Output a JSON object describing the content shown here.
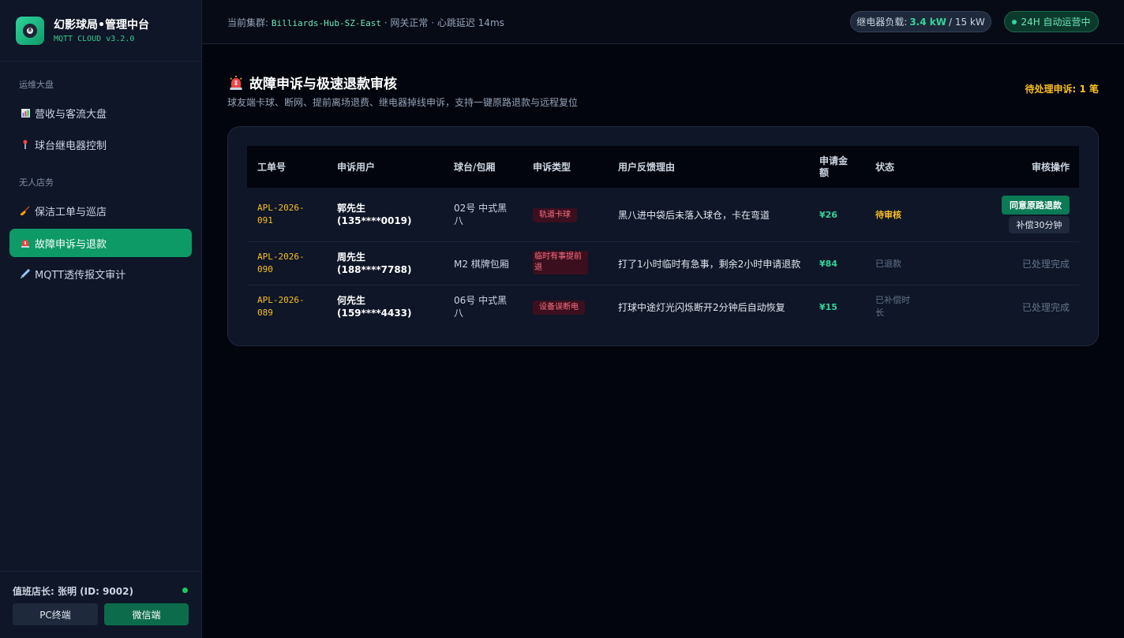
{
  "brand": {
    "title": "幻影球局•管理中台",
    "version": "MQTT CLOUD v3.2.0"
  },
  "sidebar": {
    "sections": [
      {
        "title": "运维大盘"
      },
      {
        "title": "无人店务"
      }
    ],
    "items": [
      {
        "label": "营收与客流大盘",
        "icon": "bar-chart-icon"
      },
      {
        "label": "球台继电器控制",
        "icon": "switch-icon"
      },
      {
        "label": "保洁工单与巡店",
        "icon": "broom-icon"
      },
      {
        "label": "故障申诉与退款",
        "icon": "siren-icon"
      },
      {
        "label": "MQTT透传报文审计",
        "icon": "syringe-icon"
      }
    ],
    "manager": "值班店长: 张明 (ID: 9002)",
    "pc_button": "PC终端",
    "wechat_button": "微信端"
  },
  "topbar": {
    "cluster_label": "当前集群:",
    "cluster_name": "Billiards-Hub-SZ-East",
    "cluster_status": "· 网关正常 · 心跳延迟 14ms",
    "load_label": "继电器负载:",
    "load_value": "3.4 kW",
    "load_max": "/ 15 kW",
    "ops_status": "24H 自动运营中"
  },
  "page": {
    "title": "故障申诉与极速退款审核",
    "subtitle": "球友端卡球、断网、提前离场退费、继电器掉线申诉，支持一键原路退款与远程复位",
    "pending": "待处理申诉: 1 笔"
  },
  "table": {
    "headers": {
      "id": "工单号",
      "user": "申诉用户",
      "table": "球台/包厢",
      "type": "申诉类型",
      "reason": "用户反馈理由",
      "amount": "申请金额",
      "status": "状态",
      "action": "审核操作"
    },
    "rows": [
      {
        "id": "APL-2026-091",
        "user": "郭先生 (135****0019)",
        "table": "02号 中式黑八",
        "type": "轨道卡球",
        "reason": "黑八进中袋后未落入球仓，卡在弯道",
        "amount": "¥26",
        "status": "待审核",
        "approve": "同意原路退款",
        "compensate": "补偿30分钟"
      },
      {
        "id": "APL-2026-090",
        "user": "周先生 (188****7788)",
        "table": "M2 棋牌包厢",
        "type": "临时有事提前退",
        "reason": "打了1小时临时有急事，剩余2小时申请退款",
        "amount": "¥84",
        "status": "已退款",
        "done": "已处理完成"
      },
      {
        "id": "APL-2026-089",
        "user": "何先生 (159****4433)",
        "table": "06号 中式黑八",
        "type": "设备误断电",
        "reason": "打球中途灯光闪烁断开2分钟后自动恢复",
        "amount": "¥15",
        "status": "已补偿时长",
        "done": "已处理完成"
      }
    ]
  },
  "colors": {
    "accent": "#0d9a67",
    "warning": "#fbbf24",
    "danger": "#fb7185",
    "money": "#34d399"
  }
}
